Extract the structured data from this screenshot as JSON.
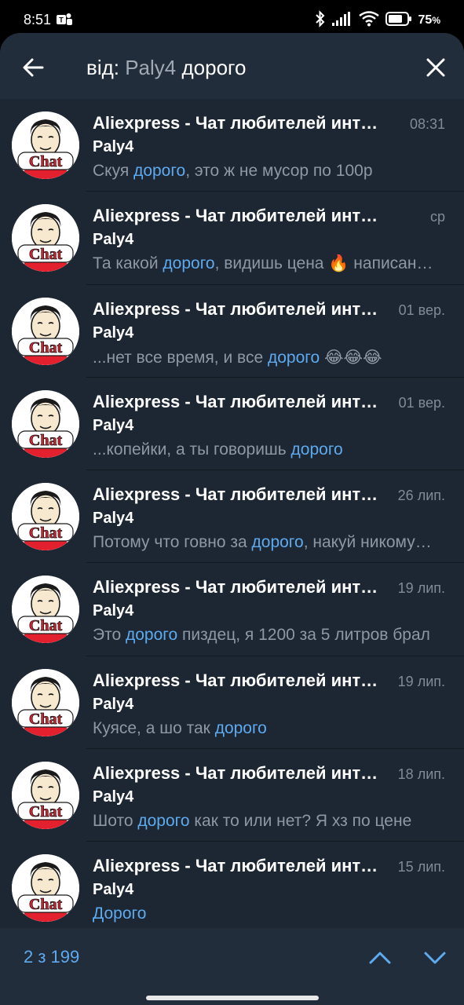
{
  "status": {
    "time": "8:51",
    "battery": "75"
  },
  "search": {
    "prefix": "від: ",
    "chip": "Paly4",
    "term": " дорого"
  },
  "avatar": {
    "label": "Chat"
  },
  "results": [
    {
      "title": "Aliexpress - Чат любителей интернет-шопинга",
      "date": "08:31",
      "sender": "Paly4",
      "pre": "Скуя ",
      "hl": "дорого",
      "post": ", это ж не мусор по 100р"
    },
    {
      "title": "Aliexpress - Чат любителей интернет-шопинга",
      "date": "ср",
      "sender": "Paly4",
      "pre": "Та какой ",
      "hl": "дорого",
      "post": ", видишь цена 🔥 написано на сайте"
    },
    {
      "title": "Aliexpress - Чат любителей интернет-шопинга",
      "date": "01 вер.",
      "sender": "Paly4",
      "pre": "...нет все время, и все ",
      "hl": "дорого",
      "post": " 😂😂😂"
    },
    {
      "title": "Aliexpress - Чат любителей интернет-шопинга",
      "date": "01 вер.",
      "sender": "Paly4",
      "pre": "...копейки, а ты говоришь ",
      "hl": "дорого",
      "post": ""
    },
    {
      "title": "Aliexpress - Чат любителей интернет-шопинга",
      "date": "26 лип.",
      "sender": "Paly4",
      "pre": "Потому что говно за ",
      "hl": "дорого",
      "post": ", накуй никому не нужно"
    },
    {
      "title": "Aliexpress - Чат любителей интернет-шопинга",
      "date": "19 лип.",
      "sender": "Paly4",
      "pre": "Это ",
      "hl": "дорого",
      "post": " пиздец, я 1200 за 5 литров брал"
    },
    {
      "title": "Aliexpress - Чат любителей интернет-шопинга",
      "date": "19 лип.",
      "sender": "Paly4",
      "pre": "Куясе, а шо так ",
      "hl": "дорого",
      "post": ""
    },
    {
      "title": "Aliexpress - Чат любителей интернет-шопинга",
      "date": "18 лип.",
      "sender": "Paly4",
      "pre": "Шото ",
      "hl": "дорого",
      "post": " как то или нет? Я хз по цене"
    },
    {
      "title": "Aliexpress - Чат любителей интернет-шопинга",
      "date": "15 лип.",
      "sender": "Paly4",
      "pre": "",
      "hl": "Дорого",
      "post": ""
    }
  ],
  "counter": "2 з 199",
  "colors": {
    "background": "#1d2733",
    "bars": "#212d3b",
    "accent": "#5eaaef",
    "muted": "#8d98a4",
    "avatar_red": "#e3202e"
  },
  "icons": {
    "back": "arrow-left-icon",
    "close": "close-icon",
    "up": "chevron-up-icon",
    "down": "chevron-down-icon",
    "bluetooth": "bluetooth-icon",
    "signal": "signal-icon",
    "wifi": "wifi-icon",
    "battery": "battery-icon",
    "teams": "teams-app-icon"
  }
}
